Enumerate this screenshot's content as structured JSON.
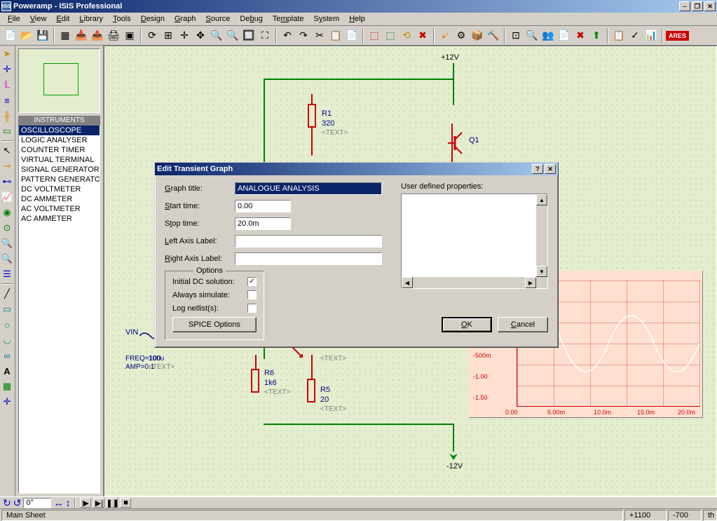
{
  "title": "Poweramp - ISIS Professional",
  "menu": [
    "File",
    "View",
    "Edit",
    "Library",
    "Tools",
    "Design",
    "Graph",
    "Source",
    "Debug",
    "Template",
    "System",
    "Help"
  ],
  "instruments_header": "INSTRUMENTS",
  "instruments": [
    "OSCILLOSCOPE",
    "LOGIC ANALYSER",
    "COUNTER TIMER",
    "VIRTUAL TERMINAL",
    "SIGNAL GENERATOR",
    "PATTERN GENERATOR",
    "DC VOLTMETER",
    "DC AMMETER",
    "AC VOLTMETER",
    "AC AMMETER"
  ],
  "canvas": {
    "top_rail": "+12V",
    "bottom_rail": "-12V",
    "components": {
      "R1": {
        "name": "R1",
        "val": "320",
        "txt": "<TEXT>"
      },
      "Q1": {
        "name": "Q1"
      },
      "R5": {
        "name": "R5",
        "val": "20",
        "txt": "<TEXT>"
      },
      "R6": {
        "name": "R6",
        "val": "1k6",
        "txt": "<TEXT>"
      },
      "C4": {
        "name": "",
        "val": "100u",
        "txt": "<TEXT>"
      },
      "VIN": {
        "name": "VIN",
        "freq": "FREQ=100",
        "amp": "AMP=0.1"
      }
    },
    "graph_title": "GUE  ANALYSIS",
    "graph_ylabels": [
      "-500m",
      "-1.00",
      "-1.50"
    ],
    "graph_xlabels": [
      "0.00",
      "5.00m",
      "10.0m",
      "15.0m",
      "20.0m"
    ]
  },
  "dialog": {
    "title": "Edit Transient Graph",
    "labels": {
      "graph_title": "Graph title:",
      "start_time": "Start time:",
      "stop_time": "Stop time:",
      "left_axis": "Left Axis Label:",
      "right_axis": "Right Axis Label:",
      "options": "Options",
      "initial_dc": "Initial DC solution:",
      "always_sim": "Always simulate:",
      "log_netlist": "Log netlist(s):",
      "spice": "SPICE Options",
      "user_props": "User defined properties:",
      "ok": "OK",
      "cancel": "Cancel"
    },
    "values": {
      "graph_title": "ANALOGUE ANALYSIS",
      "start_time": "0.00",
      "stop_time": "20.0m",
      "left_axis": "",
      "right_axis": "",
      "initial_dc": true,
      "always_sim": false,
      "log_netlist": false
    }
  },
  "status": {
    "angle": "0°",
    "sheet": "Main Sheet",
    "coord_x": "+1100",
    "coord_y": "-700",
    "unit": "th"
  },
  "ares_badge": "ARES"
}
